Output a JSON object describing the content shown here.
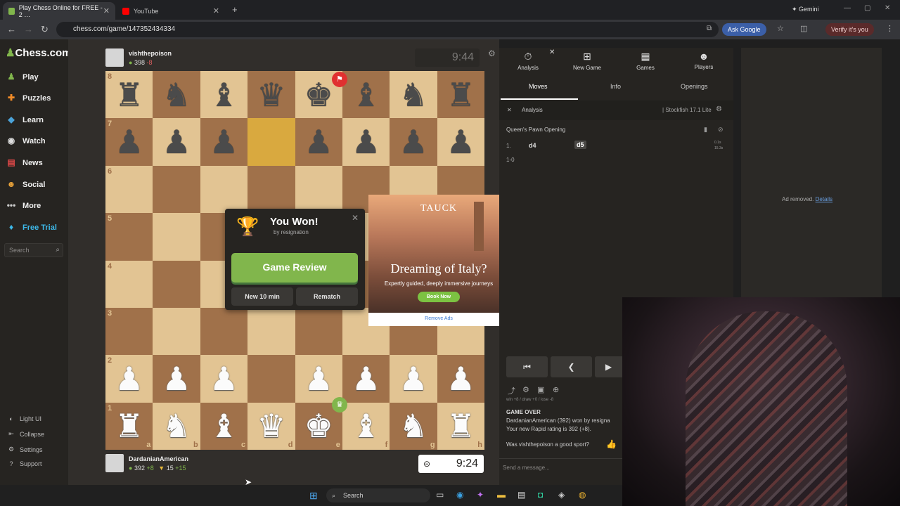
{
  "browser": {
    "tabs": [
      {
        "title": "Play Chess Online for FREE - 2 …",
        "active": true
      },
      {
        "title": "YouTube",
        "active": false
      }
    ],
    "url": "chess.com/game/147352434334",
    "gemini_label": "Gemini",
    "ask_google": "Ask Google",
    "verify": "Verify it's you"
  },
  "sidebar": {
    "logo": "Chess.com",
    "logo_badge": "1",
    "items": [
      {
        "label": "Play",
        "icon": "pawn-icon"
      },
      {
        "label": "Puzzles",
        "icon": "puzzle-icon"
      },
      {
        "label": "Learn",
        "icon": "learn-icon"
      },
      {
        "label": "Watch",
        "icon": "binoculars-icon"
      },
      {
        "label": "News",
        "icon": "news-icon"
      },
      {
        "label": "Social",
        "icon": "social-icon"
      },
      {
        "label": "More",
        "icon": "more-icon"
      },
      {
        "label": "Free Trial",
        "icon": "diamond-icon"
      }
    ],
    "search_placeholder": "Search",
    "footer": [
      {
        "label": "Light UI"
      },
      {
        "label": "Collapse"
      },
      {
        "label": "Settings"
      },
      {
        "label": "Support"
      }
    ]
  },
  "game": {
    "top_player": {
      "name": "vishthepoison",
      "rating": "398",
      "delta": "-8",
      "clock": "9:44"
    },
    "bottom_player": {
      "name": "DardanianAmerican",
      "rating": "392",
      "delta": "+8",
      "points": "15",
      "points_delta": "+15",
      "clock": "9:24"
    },
    "ranks": [
      "8",
      "7",
      "6",
      "5",
      "4",
      "3",
      "2",
      "1"
    ],
    "files": [
      "a",
      "b",
      "c",
      "d",
      "e",
      "f",
      "g",
      "h"
    ],
    "position": [
      [
        "br",
        "bn",
        "bb",
        "bq",
        "bk",
        "bb",
        "bn",
        "br"
      ],
      [
        "bp",
        "bp",
        "bp",
        "",
        "bp",
        "bp",
        "bp",
        "bp"
      ],
      [
        "",
        "",
        "",
        "",
        "",
        "",
        "",
        ""
      ],
      [
        "",
        "",
        "",
        "",
        "",
        "",
        "",
        ""
      ],
      [
        "",
        "",
        "",
        "",
        "",
        "",
        "",
        ""
      ],
      [
        "",
        "",
        "",
        "",
        "",
        "",
        "",
        ""
      ],
      [
        "wp",
        "wp",
        "wp",
        "",
        "wp",
        "wp",
        "wp",
        "wp"
      ],
      [
        "wr",
        "wn",
        "wb",
        "wq",
        "wk",
        "wb",
        "wn",
        "wr"
      ]
    ],
    "highlight_squares": [
      "d7"
    ],
    "popup": {
      "title": "You Won!",
      "subtitle": "by resignation",
      "review": "Game Review",
      "new_game": "New 10 min",
      "rematch": "Rematch"
    }
  },
  "ad": {
    "brand": "TAUCK",
    "headline": "Dreaming of Italy?",
    "tagline": "Expertly guided, deeply immersive journeys",
    "cta": "Book Now",
    "remove": "Remove Ads"
  },
  "panel": {
    "tabs": [
      "Analysis",
      "New Game",
      "Games",
      "Players"
    ],
    "subtabs": [
      "Moves",
      "Info",
      "Openings"
    ],
    "analysis_label": "Analysis",
    "engine": "Stockfish 17.1 Lite",
    "opening": "Queen's Pawn Opening",
    "moves": [
      {
        "num": "1.",
        "white": "d4",
        "black": "d5"
      }
    ],
    "move_times": [
      "0.1s",
      "15.3s"
    ],
    "result": "1-0",
    "chat_partial": "win +8 / draw +0 / lose -8",
    "game_over_title": "GAME OVER",
    "game_over_line1": "DardanianAmerican (392) won by resigna",
    "game_over_line2": "Your new Rapid rating is 392 (+8).",
    "sport_question": "Was vishthepoison a good sport?",
    "message_placeholder": "Send a message...",
    "ad_removed": "Ad removed.",
    "details": "Details"
  },
  "taskbar": {
    "search": "Search"
  },
  "colors": {
    "accent_green": "#81b64c",
    "board_light": "#e2c493",
    "board_dark": "#a0714a"
  }
}
